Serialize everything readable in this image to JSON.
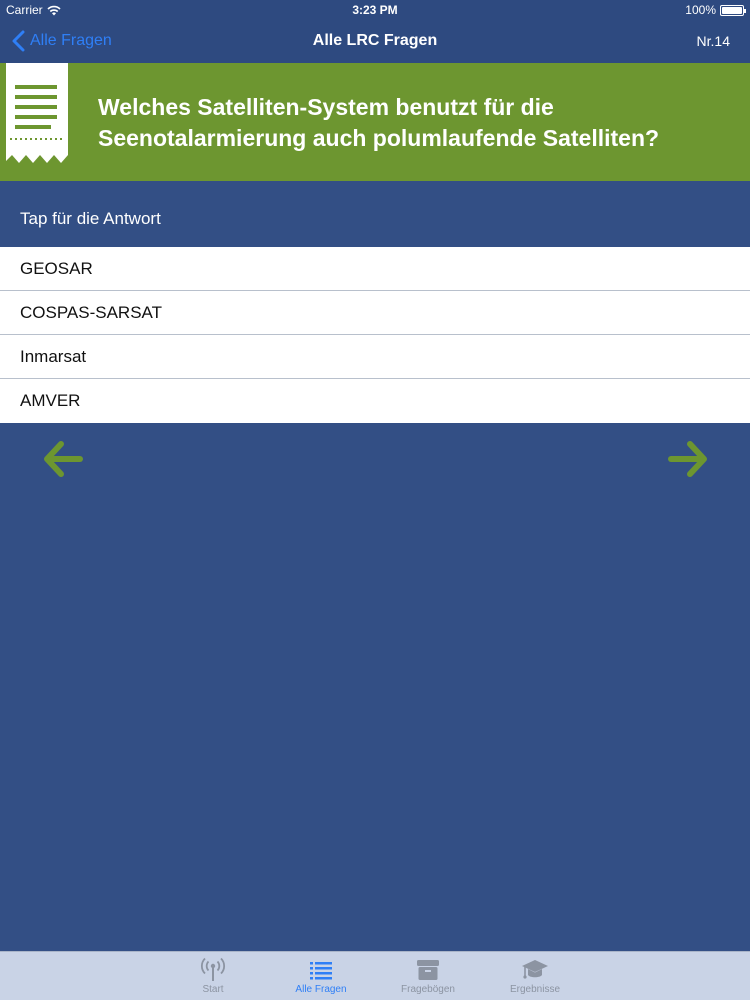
{
  "status_bar": {
    "carrier": "Carrier",
    "time": "3:23 PM",
    "battery": "100%",
    "battery_level": 1.0
  },
  "nav": {
    "back_label": "Alle Fragen",
    "title": "Alle LRC Fragen",
    "number": "Nr.14"
  },
  "question": {
    "line1": "Welches Satelliten-System benutzt für die",
    "line2": "Seenotalarmierung auch polumlaufende Satelliten?"
  },
  "hint": "Tap für die Antwort",
  "answers": [
    "GEOSAR",
    "COSPAS-SARSAT",
    "Inmarsat",
    "AMVER"
  ],
  "navigation_arrows": {
    "previous_icon": "arrow-left-icon",
    "next_icon": "arrow-right-icon",
    "color": "#6d9630"
  },
  "tab_bar": {
    "tabs": [
      {
        "label": "Start",
        "icon": "antenna-icon",
        "active": false
      },
      {
        "label": "Alle Fragen",
        "icon": "list-icon",
        "active": true
      },
      {
        "label": "Fragebögen",
        "icon": "archive-box-icon",
        "active": false
      },
      {
        "label": "Ergebnisse",
        "icon": "graduation-cap-icon",
        "active": false
      }
    ]
  },
  "colors": {
    "background": "#334f85",
    "bar": "#2e4a80",
    "accent_green": "#6d9630",
    "ios_blue": "#2f7ff6",
    "tab_bar": "#c9d3e6"
  }
}
